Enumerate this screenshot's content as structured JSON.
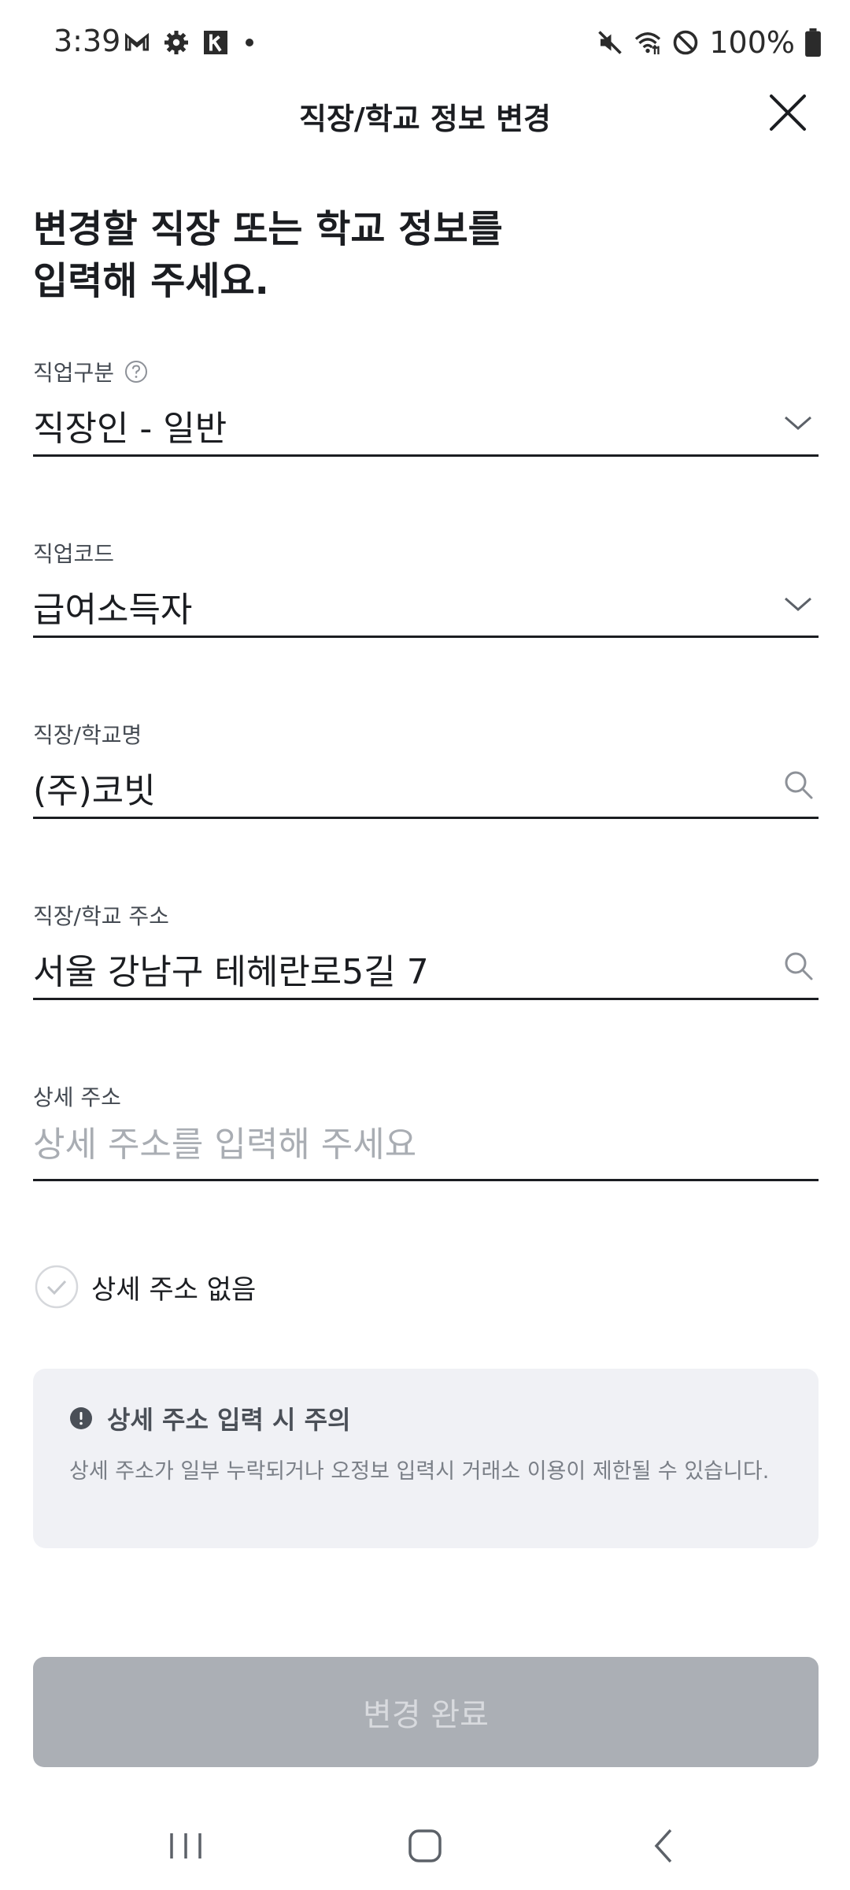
{
  "status_bar": {
    "time": "3:39",
    "battery": "100%",
    "left_icons": [
      "gmail-icon",
      "settings-icon",
      "k-app-icon",
      "notification-dot"
    ],
    "right_icons": [
      "mute-icon",
      "wifi-icon",
      "do-not-disturb-icon",
      "battery-icon"
    ]
  },
  "header": {
    "title": "직장/학교 정보 변경",
    "close_icon": "close-icon"
  },
  "heading": {
    "line1": "변경할 직장 또는 학교 정보를",
    "line2": "입력해 주세요."
  },
  "fields": {
    "job_type": {
      "label": "직업구분",
      "value": "직장인 - 일반",
      "icon": "chevron-down-icon",
      "help_icon": "help-icon"
    },
    "job_code": {
      "label": "직업코드",
      "value": "급여소득자",
      "icon": "chevron-down-icon"
    },
    "workplace_name": {
      "label": "직장/학교명",
      "value": "(주)코빗",
      "icon": "search-icon"
    },
    "workplace_address": {
      "label": "직장/학교 주소",
      "value": "서울 강남구 테헤란로5길 7",
      "icon": "search-icon"
    },
    "detail_address": {
      "label": "상세 주소",
      "value": "",
      "placeholder": "상세 주소를 입력해 주세요"
    }
  },
  "no_detail_checkbox": {
    "label": "상세 주소 없음",
    "checked": false
  },
  "notice": {
    "title": "상세 주소 입력 시 주의",
    "body": "상세 주소가 일부 누락되거나 오정보 입력시 거래소 이용이 제한될 수 있습니다."
  },
  "submit": {
    "label": "변경 완료",
    "enabled": false
  },
  "colors": {
    "text": "#1b1d21",
    "placeholder": "#a9adb3",
    "notice_bg": "#f0f1f5",
    "button_disabled_bg": "#abafb5",
    "button_disabled_text": "#d8dade"
  }
}
